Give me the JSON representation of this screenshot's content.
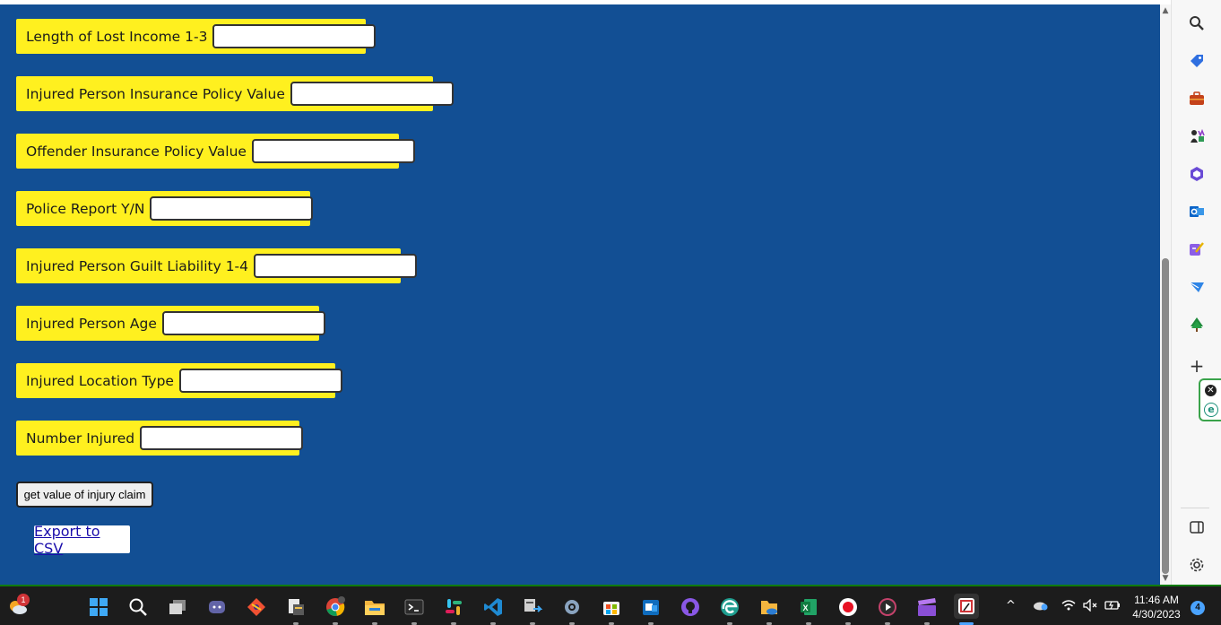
{
  "form": {
    "fields": [
      {
        "label": "Length of Lost Income 1-3",
        "value": ""
      },
      {
        "label": "Injured Person Insurance Policy Value",
        "value": ""
      },
      {
        "label": "Offender Insurance Policy Value",
        "value": ""
      },
      {
        "label": "Police Report Y/N",
        "value": ""
      },
      {
        "label": "Injured Person Guilt Liability 1-4",
        "value": ""
      },
      {
        "label": "Injured Person Age",
        "value": ""
      },
      {
        "label": "Injured Location Type",
        "value": ""
      },
      {
        "label": "Number Injured",
        "value": ""
      }
    ],
    "submit_label": "get value of injury claim",
    "export_label": "Export to CSV"
  },
  "colors": {
    "page_bg": "#124f94",
    "field_bg": "#fff01f",
    "taskbar_bg": "#1c1c1c"
  },
  "sidebar": {
    "icons": [
      "search-icon",
      "tag-icon",
      "briefcase-icon",
      "chess-icon",
      "office-icon",
      "outlook-icon",
      "designer-icon",
      "send-icon",
      "tree-icon",
      "add-icon",
      "extension-close-icon",
      "extension-e-icon",
      "sidebar-toggle-icon",
      "settings-icon"
    ]
  },
  "taskbar": {
    "weather_badge": "1",
    "icons": [
      "start-icon",
      "search-icon",
      "task-view-icon",
      "teams-icon",
      "git-icon",
      "file-manager-icon",
      "chrome-icon",
      "file-explorer-icon",
      "terminal-icon",
      "slack-icon",
      "vscode-icon",
      "remote-icon",
      "settings-icon",
      "store-icon",
      "outlook-icon",
      "github-icon",
      "edge-icon",
      "onedrive-folder-icon",
      "excel-icon",
      "record-icon",
      "media-player-icon",
      "clapper-icon",
      "snipping-icon"
    ],
    "time": "11:46 AM",
    "date": "4/30/2023",
    "notification_count": "4"
  }
}
